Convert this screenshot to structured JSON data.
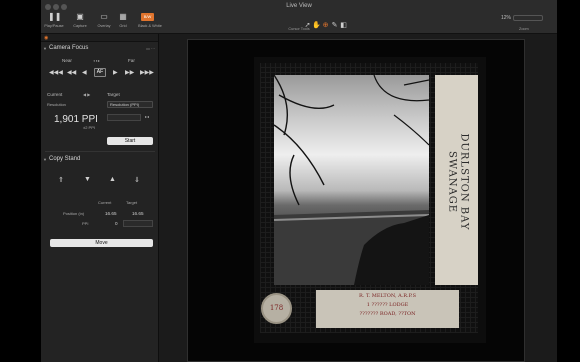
{
  "window": {
    "title": "Live View"
  },
  "toolbar": {
    "buttons": [
      {
        "label": "Play/Pause",
        "icon": "pause-icon"
      },
      {
        "label": "Capture",
        "icon": "camera-icon"
      },
      {
        "label": "Overlay",
        "icon": "overlay-icon"
      },
      {
        "label": "Grid",
        "icon": "grid-icon"
      },
      {
        "label": "Black & White",
        "icon": "bw-icon"
      }
    ],
    "bw_badge": "B/W",
    "cursor_tools_label": "Cursor Tools",
    "zoom_value": "12%",
    "zoom_label": "Zoom"
  },
  "camera_focus": {
    "title": "Camera Focus",
    "near": "Near",
    "far": "Far",
    "af": "AF",
    "current_label": "Current",
    "target_label": "Target",
    "resolution_label": "Resolution",
    "target_select": "Resolution (PPI)",
    "current_value": "1,901 PPI",
    "current_sub": "±2 PPI",
    "start_button": "Start"
  },
  "copy_stand": {
    "title": "Copy Stand",
    "current_header": "Current",
    "target_header": "Target",
    "rows": [
      {
        "label": "Position (in)",
        "current": "16.65",
        "target": "16.65"
      },
      {
        "label": "PPI",
        "current": "0",
        "target": ""
      }
    ],
    "move_button": "Move"
  },
  "image": {
    "side_label_line1": "DURLSTON BAY",
    "side_label_line2": "SWANAGE",
    "credit_line1": "R. T. MELTON, A.R.P.S",
    "credit_line2": "1 ?????? LODGE",
    "credit_line3": "??????? ROAD, ??TON",
    "stamp_text": "178"
  },
  "colors": {
    "accent": "#e0742d",
    "panel": "#232323",
    "button": "#e6e6e6"
  }
}
